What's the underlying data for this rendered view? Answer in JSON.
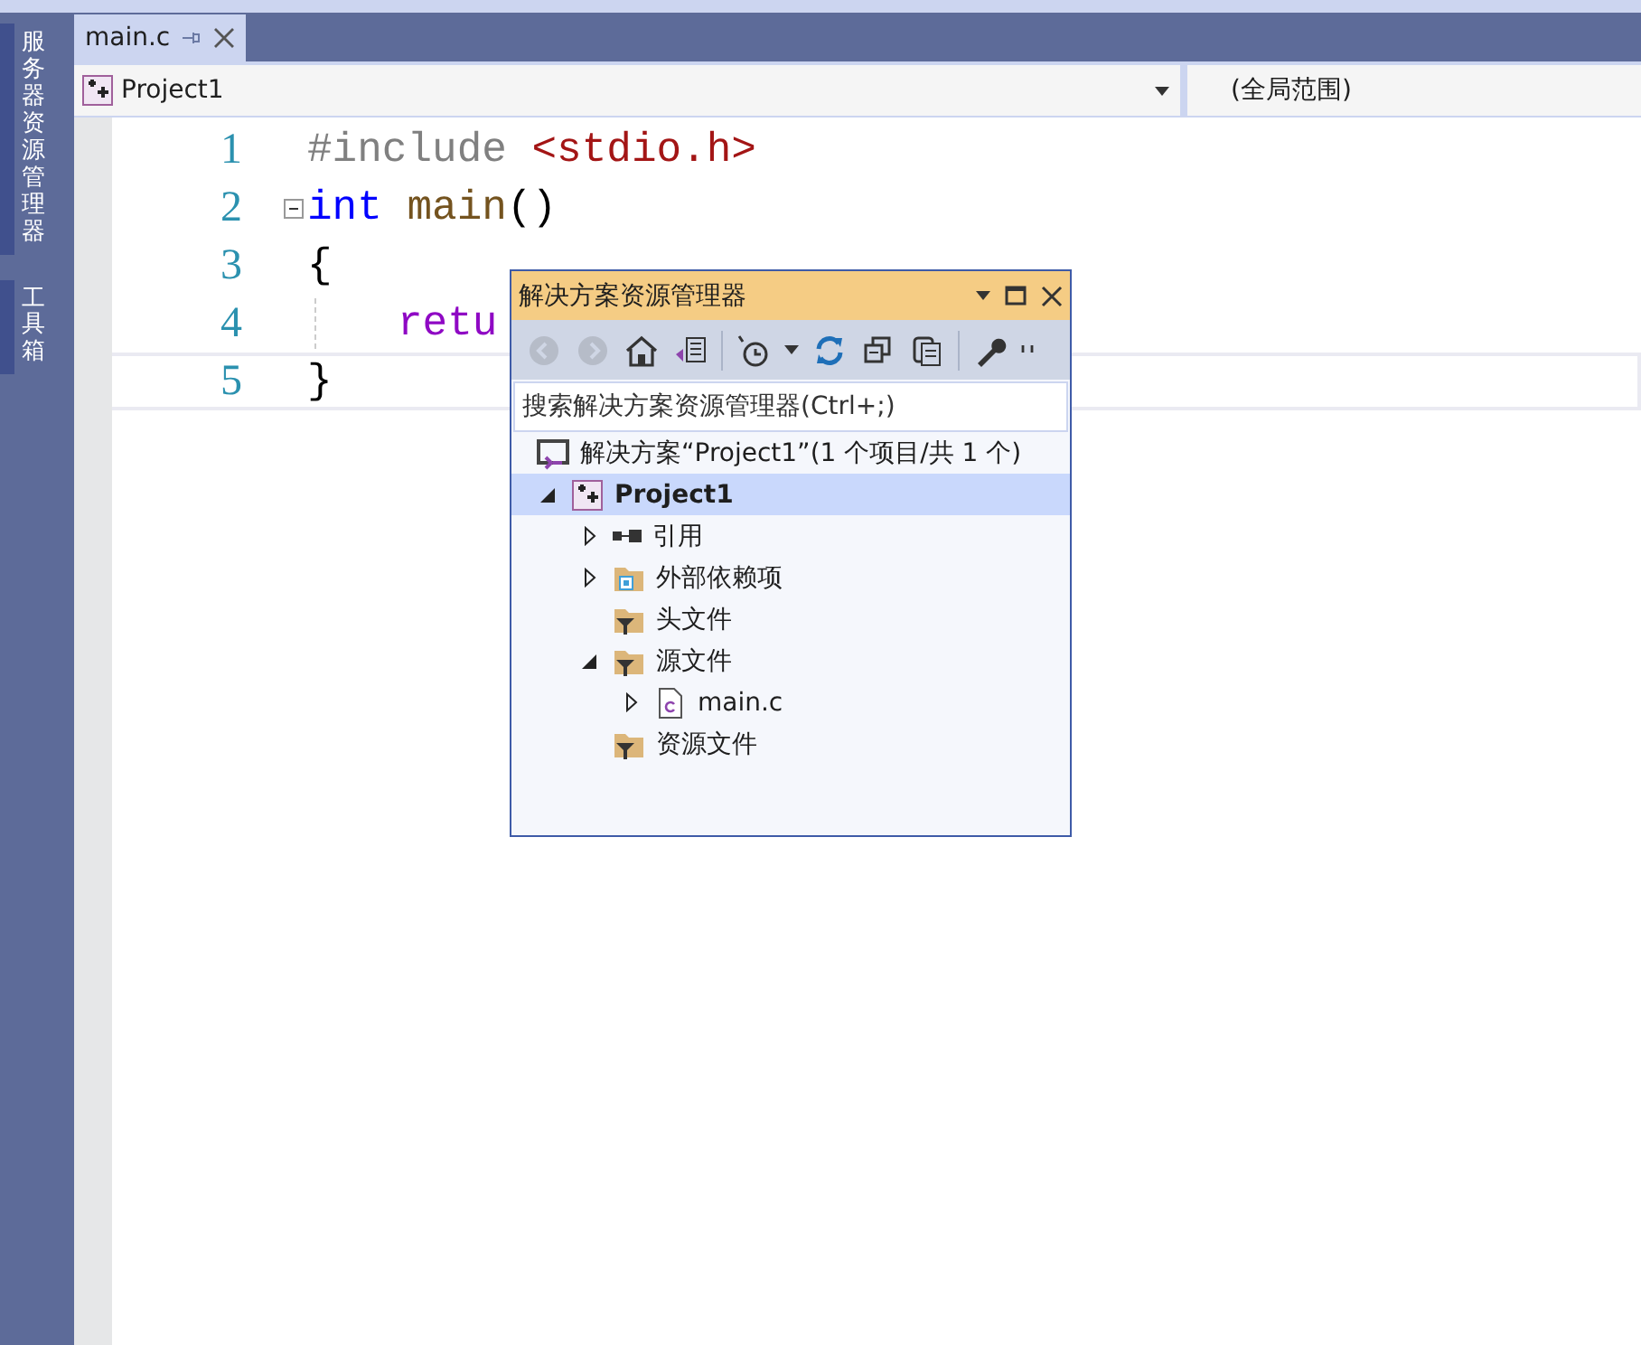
{
  "side_tabs": [
    {
      "label": "服务器资源管理器"
    },
    {
      "label": "工具箱"
    }
  ],
  "doc_tabs": [
    {
      "label": "main.c",
      "selected": true
    }
  ],
  "nav_bar": {
    "project": "Project1",
    "scope": "(全局范围)"
  },
  "code_lines": [
    {
      "number": "1",
      "foldable": false,
      "indented": false,
      "current": false,
      "tokens": [
        {
          "kind": "preprocessor",
          "text": "#include "
        },
        {
          "kind": "header",
          "text": "<stdio.h>"
        }
      ]
    },
    {
      "number": "2",
      "foldable": true,
      "indented": false,
      "current": false,
      "tokens": [
        {
          "kind": "keyword",
          "text": "int "
        },
        {
          "kind": "function",
          "text": "main"
        },
        {
          "kind": "plain",
          "text": "()"
        }
      ]
    },
    {
      "number": "3",
      "foldable": false,
      "indented": false,
      "current": false,
      "tokens": [
        {
          "kind": "plain",
          "text": "{"
        }
      ]
    },
    {
      "number": "4",
      "foldable": false,
      "indented": true,
      "current": false,
      "tokens": [
        {
          "kind": "control",
          "text": "retu"
        }
      ]
    },
    {
      "number": "5",
      "foldable": false,
      "indented": false,
      "current": true,
      "tokens": [
        {
          "kind": "plain",
          "text": "}"
        }
      ]
    }
  ],
  "solution_explorer": {
    "title": "解决方案资源管理器",
    "search": {
      "placeholder": "搜索解决方案资源管理器(Ctrl+;)"
    },
    "tree": [
      {
        "label": "解决方案“Project1”(1 个项目/共 1 个)",
        "kind": "solution",
        "selected": false,
        "children": [
          {
            "label": "Project1",
            "kind": "project",
            "expanded": true,
            "selected": true,
            "children": [
              {
                "label": "引用",
                "kind": "references",
                "expanded": false,
                "selected": false
              },
              {
                "label": "外部依赖项",
                "kind": "external",
                "expanded": false,
                "selected": false
              },
              {
                "label": "头文件",
                "kind": "filter",
                "selected": false
              },
              {
                "label": "源文件",
                "kind": "filter",
                "expanded": true,
                "selected": false,
                "children": [
                  {
                    "label": "main.c",
                    "kind": "file",
                    "expanded": false,
                    "selected": false
                  }
                ]
              },
              {
                "label": "资源文件",
                "kind": "filter",
                "selected": false
              }
            ]
          }
        ]
      }
    ]
  }
}
